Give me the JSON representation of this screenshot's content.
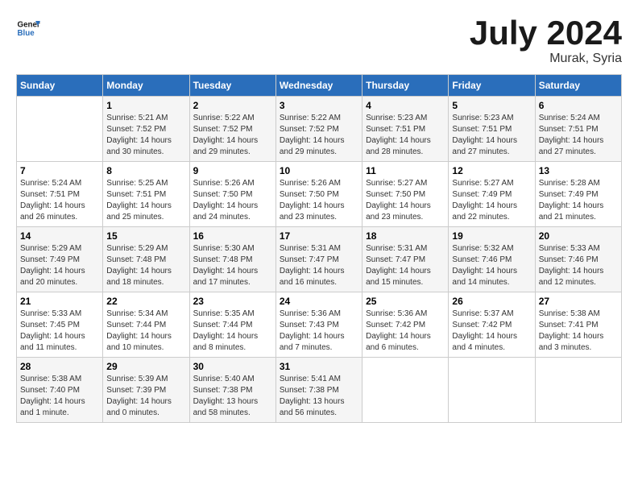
{
  "logo": {
    "line1": "General",
    "line2": "Blue"
  },
  "title": "July 2024",
  "location": "Murak, Syria",
  "days_of_week": [
    "Sunday",
    "Monday",
    "Tuesday",
    "Wednesday",
    "Thursday",
    "Friday",
    "Saturday"
  ],
  "weeks": [
    [
      {
        "day": "",
        "info": ""
      },
      {
        "day": "1",
        "info": "Sunrise: 5:21 AM\nSunset: 7:52 PM\nDaylight: 14 hours\nand 30 minutes."
      },
      {
        "day": "2",
        "info": "Sunrise: 5:22 AM\nSunset: 7:52 PM\nDaylight: 14 hours\nand 29 minutes."
      },
      {
        "day": "3",
        "info": "Sunrise: 5:22 AM\nSunset: 7:52 PM\nDaylight: 14 hours\nand 29 minutes."
      },
      {
        "day": "4",
        "info": "Sunrise: 5:23 AM\nSunset: 7:51 PM\nDaylight: 14 hours\nand 28 minutes."
      },
      {
        "day": "5",
        "info": "Sunrise: 5:23 AM\nSunset: 7:51 PM\nDaylight: 14 hours\nand 27 minutes."
      },
      {
        "day": "6",
        "info": "Sunrise: 5:24 AM\nSunset: 7:51 PM\nDaylight: 14 hours\nand 27 minutes."
      }
    ],
    [
      {
        "day": "7",
        "info": "Sunrise: 5:24 AM\nSunset: 7:51 PM\nDaylight: 14 hours\nand 26 minutes."
      },
      {
        "day": "8",
        "info": "Sunrise: 5:25 AM\nSunset: 7:51 PM\nDaylight: 14 hours\nand 25 minutes."
      },
      {
        "day": "9",
        "info": "Sunrise: 5:26 AM\nSunset: 7:50 PM\nDaylight: 14 hours\nand 24 minutes."
      },
      {
        "day": "10",
        "info": "Sunrise: 5:26 AM\nSunset: 7:50 PM\nDaylight: 14 hours\nand 23 minutes."
      },
      {
        "day": "11",
        "info": "Sunrise: 5:27 AM\nSunset: 7:50 PM\nDaylight: 14 hours\nand 23 minutes."
      },
      {
        "day": "12",
        "info": "Sunrise: 5:27 AM\nSunset: 7:49 PM\nDaylight: 14 hours\nand 22 minutes."
      },
      {
        "day": "13",
        "info": "Sunrise: 5:28 AM\nSunset: 7:49 PM\nDaylight: 14 hours\nand 21 minutes."
      }
    ],
    [
      {
        "day": "14",
        "info": "Sunrise: 5:29 AM\nSunset: 7:49 PM\nDaylight: 14 hours\nand 20 minutes."
      },
      {
        "day": "15",
        "info": "Sunrise: 5:29 AM\nSunset: 7:48 PM\nDaylight: 14 hours\nand 18 minutes."
      },
      {
        "day": "16",
        "info": "Sunrise: 5:30 AM\nSunset: 7:48 PM\nDaylight: 14 hours\nand 17 minutes."
      },
      {
        "day": "17",
        "info": "Sunrise: 5:31 AM\nSunset: 7:47 PM\nDaylight: 14 hours\nand 16 minutes."
      },
      {
        "day": "18",
        "info": "Sunrise: 5:31 AM\nSunset: 7:47 PM\nDaylight: 14 hours\nand 15 minutes."
      },
      {
        "day": "19",
        "info": "Sunrise: 5:32 AM\nSunset: 7:46 PM\nDaylight: 14 hours\nand 14 minutes."
      },
      {
        "day": "20",
        "info": "Sunrise: 5:33 AM\nSunset: 7:46 PM\nDaylight: 14 hours\nand 12 minutes."
      }
    ],
    [
      {
        "day": "21",
        "info": "Sunrise: 5:33 AM\nSunset: 7:45 PM\nDaylight: 14 hours\nand 11 minutes."
      },
      {
        "day": "22",
        "info": "Sunrise: 5:34 AM\nSunset: 7:44 PM\nDaylight: 14 hours\nand 10 minutes."
      },
      {
        "day": "23",
        "info": "Sunrise: 5:35 AM\nSunset: 7:44 PM\nDaylight: 14 hours\nand 8 minutes."
      },
      {
        "day": "24",
        "info": "Sunrise: 5:36 AM\nSunset: 7:43 PM\nDaylight: 14 hours\nand 7 minutes."
      },
      {
        "day": "25",
        "info": "Sunrise: 5:36 AM\nSunset: 7:42 PM\nDaylight: 14 hours\nand 6 minutes."
      },
      {
        "day": "26",
        "info": "Sunrise: 5:37 AM\nSunset: 7:42 PM\nDaylight: 14 hours\nand 4 minutes."
      },
      {
        "day": "27",
        "info": "Sunrise: 5:38 AM\nSunset: 7:41 PM\nDaylight: 14 hours\nand 3 minutes."
      }
    ],
    [
      {
        "day": "28",
        "info": "Sunrise: 5:38 AM\nSunset: 7:40 PM\nDaylight: 14 hours\nand 1 minute."
      },
      {
        "day": "29",
        "info": "Sunrise: 5:39 AM\nSunset: 7:39 PM\nDaylight: 14 hours\nand 0 minutes."
      },
      {
        "day": "30",
        "info": "Sunrise: 5:40 AM\nSunset: 7:38 PM\nDaylight: 13 hours\nand 58 minutes."
      },
      {
        "day": "31",
        "info": "Sunrise: 5:41 AM\nSunset: 7:38 PM\nDaylight: 13 hours\nand 56 minutes."
      },
      {
        "day": "",
        "info": ""
      },
      {
        "day": "",
        "info": ""
      },
      {
        "day": "",
        "info": ""
      }
    ]
  ]
}
